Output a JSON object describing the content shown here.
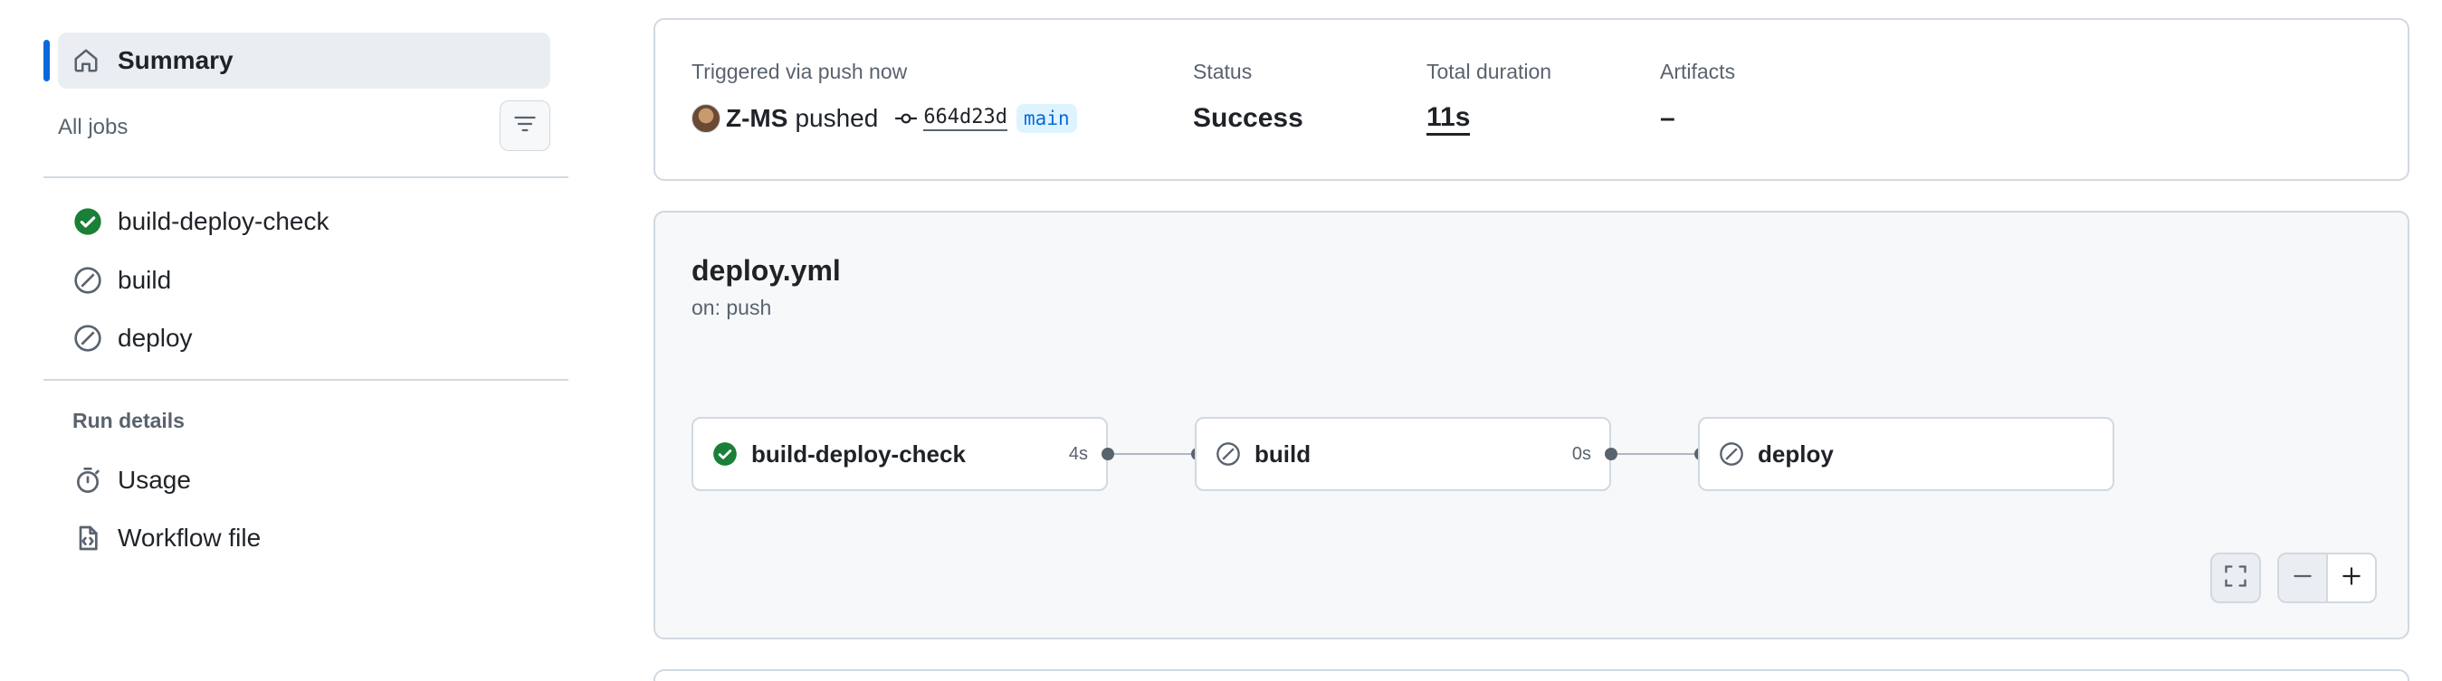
{
  "sidebar": {
    "summary_label": "Summary",
    "all_jobs_label": "All jobs",
    "jobs": [
      {
        "label": "build-deploy-check",
        "status": "success"
      },
      {
        "label": "build",
        "status": "skipped"
      },
      {
        "label": "deploy",
        "status": "skipped"
      }
    ],
    "run_details_label": "Run details",
    "details": [
      {
        "label": "Usage",
        "icon": "stopwatch-icon"
      },
      {
        "label": "Workflow file",
        "icon": "file-code-icon"
      }
    ]
  },
  "run": {
    "trigger_label": "Triggered via push now",
    "actor": "Z-MS",
    "action": "pushed",
    "commit_sha": "664d23d",
    "branch": "main",
    "status_label": "Status",
    "status_value": "Success",
    "duration_label": "Total duration",
    "duration_value": "11s",
    "artifacts_label": "Artifacts",
    "artifacts_value": "–"
  },
  "workflow": {
    "title": "deploy.yml",
    "trigger": "on: push",
    "jobs": [
      {
        "name": "build-deploy-check",
        "duration": "4s",
        "status": "success"
      },
      {
        "name": "build",
        "duration": "0s",
        "status": "skipped"
      },
      {
        "name": "deploy",
        "duration": "",
        "status": "skipped"
      }
    ]
  },
  "colors": {
    "accent": "#0969da",
    "success": "#1a7f37",
    "muted": "#59636e",
    "border": "#d1d9e0"
  }
}
